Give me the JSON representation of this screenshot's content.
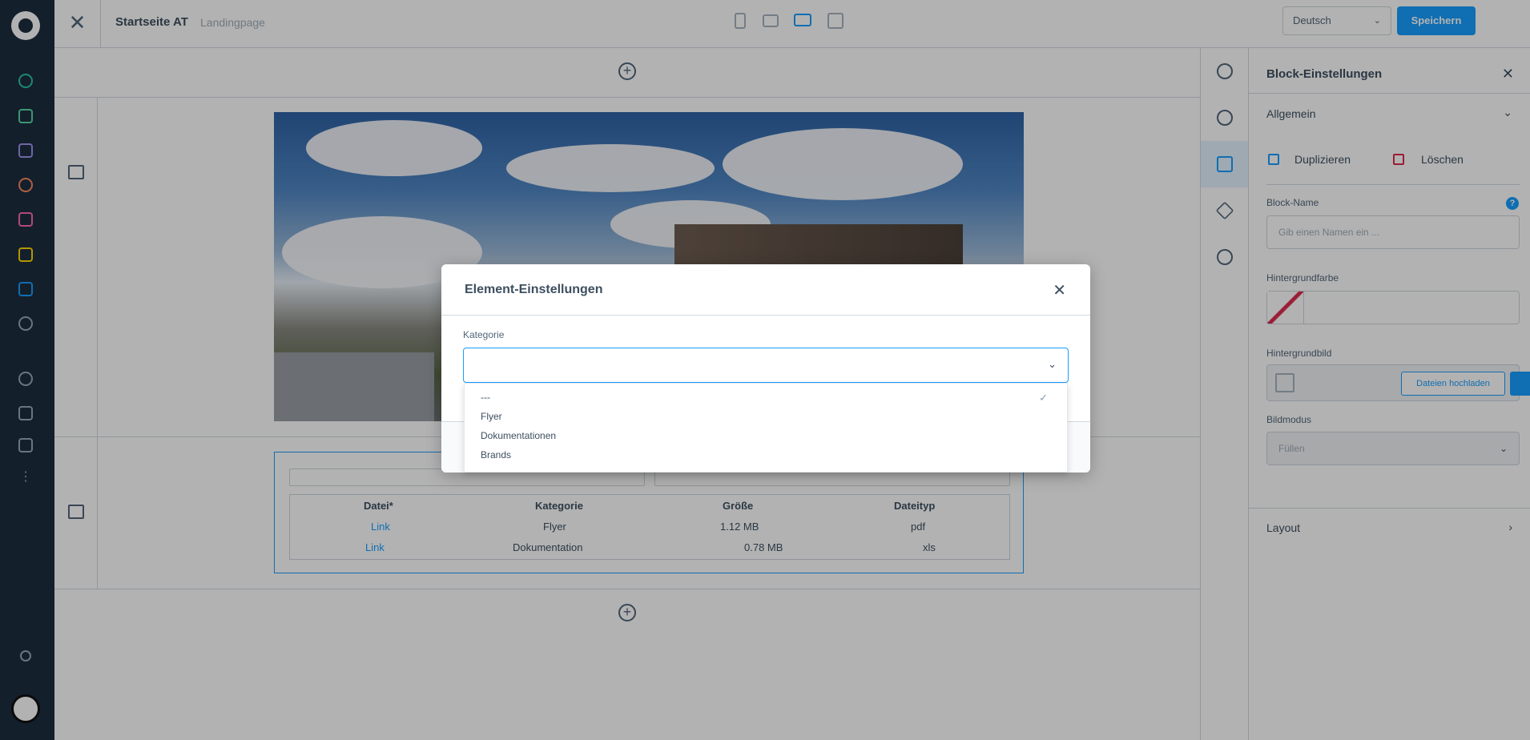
{
  "topbar": {
    "page_title": "Startseite AT",
    "page_type": "Landingpage",
    "language": "Deutsch",
    "save_label": "Speichern"
  },
  "file_table": {
    "headers": [
      "Datei*",
      "Kategorie",
      "Größe",
      "Dateityp"
    ],
    "rows": [
      [
        "Link",
        "Flyer",
        "1.12 MB",
        "pdf"
      ],
      [
        "Link",
        "Dokumentation",
        "0.78 MB",
        "xls"
      ]
    ]
  },
  "modal": {
    "title": "Element-Einstellungen",
    "category_label": "Kategorie",
    "category_value": "",
    "options": [
      "---",
      "Flyer",
      "Dokumentationen",
      "Brands"
    ],
    "selected_index": 0
  },
  "settings": {
    "title": "Block-Einstellungen",
    "general": "Allgemein",
    "duplicate": "Duplizieren",
    "delete": "Löschen",
    "block_name_label": "Block-Name",
    "block_name_placeholder": "Gib einen Namen ein ...",
    "bg_color_label": "Hintergrundfarbe",
    "bg_image_label": "Hintergrundbild",
    "upload_label": "Dateien hochladen",
    "image_mode_label": "Bildmodus",
    "image_mode_value": "Füllen",
    "layout": "Layout"
  },
  "colors": {
    "accent": "#189eff",
    "sidebar": "#1d2d3f",
    "delete": "#de294c"
  }
}
